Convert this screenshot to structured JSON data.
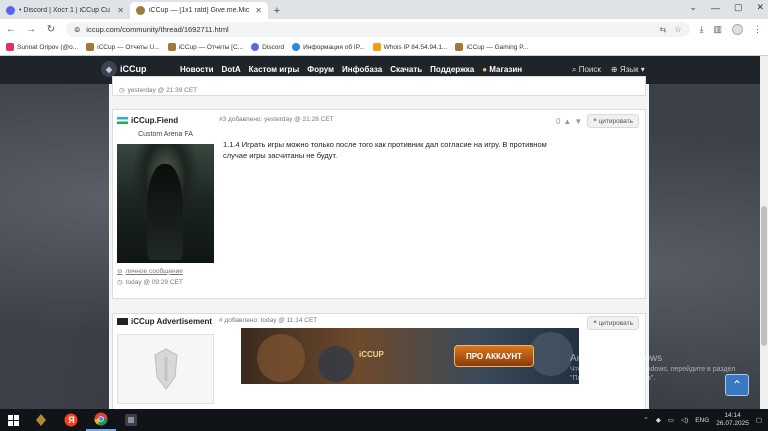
{
  "browser": {
    "tabs": [
      {
        "title": "• Discord | Хост 1 | iCCup Cu",
        "active": false
      },
      {
        "title": "iCCup — [1x1 ratd] Give.me.Mic",
        "active": true
      }
    ],
    "url": "iccup.com/community/thread/1692711.html",
    "bookmarks": [
      "Sunnat Oripov (@o...",
      "iCCup — Отчеты U...",
      "iCCup — Отчеты [C...",
      "Discord",
      "Информация об IP...",
      "Whois IP 84.54.94.1...",
      "iCCup — Gaming P..."
    ]
  },
  "site": {
    "logo": "iCCup",
    "nav": [
      "Новости",
      "DotA",
      "Кастом игры",
      "Форум",
      "Инфобаза",
      "Скачать",
      "Поддержка"
    ],
    "shop": "Магазин",
    "search": "Поиск",
    "language": "Язык"
  },
  "posts": {
    "prev": {
      "time": "yesterday @ 21:39 CET"
    },
    "reply": {
      "username": "iCCup.Fiend",
      "user_title": "Custom Arena FA",
      "header": "#3 добавлено: yesterday @ 21:28 CET",
      "votes": "0",
      "quote": "цитировать",
      "text": "1.1.4 Играть игры можно только после того как противник дал согласие на игру. В противном случае игры засчитаны не будут.",
      "pm": "личное сообщение",
      "last_seen": "today @ 09:29 CET"
    },
    "ad": {
      "username": "iCCup Advertisement",
      "header": "# добавлено: today @ 11:14 CET",
      "quote": "цитировать",
      "banner_brand": "iCCUP",
      "banner_cta": "ПРО АККАУНТ"
    }
  },
  "overlay": {
    "activation_title": "Активация Windows",
    "activation_text": "Чтобы активировать Windows, перейдите в раздел \"Параметры компьютера\"."
  },
  "taskbar": {
    "lang": "ENG",
    "time": "14:14",
    "date": "26.07.2025"
  }
}
